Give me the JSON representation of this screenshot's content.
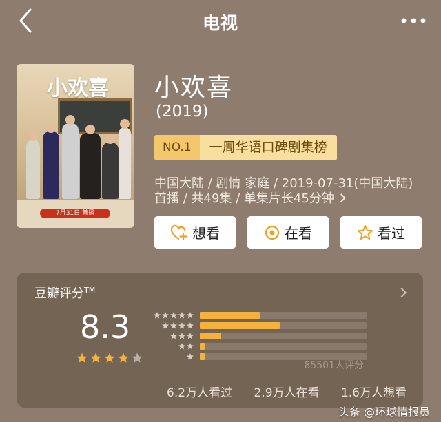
{
  "header": {
    "title": "电视",
    "back_icon": "back-chevron-icon",
    "more_icon": "more-dots-icon"
  },
  "poster": {
    "title_art": "小欢喜",
    "date_strip": "7月31日 首播"
  },
  "show": {
    "title": "小欢喜",
    "year": "(2019)",
    "rank_no": "NO.1",
    "rank_text": "一周华语口碑剧集榜",
    "meta_line1": "中国大陆 / 剧情 家庭 / 2019-07-31(中国大陆)",
    "meta_line2": "首播 / 共49集 / 单集片长45分钟"
  },
  "actions": [
    {
      "label": "想看",
      "icon": "heart-plus-icon"
    },
    {
      "label": "在看",
      "icon": "target-circle-icon"
    },
    {
      "label": "看过",
      "icon": "star-outline-icon"
    }
  ],
  "rating": {
    "label": "豆瓣评分",
    "tm": "TM",
    "score": "8.3",
    "stars_filled": 4,
    "stars_total": 5,
    "distribution": [
      {
        "stars": 5,
        "fraction": 0.36
      },
      {
        "stars": 4,
        "fraction": 0.48
      },
      {
        "stars": 3,
        "fraction": 0.13
      },
      {
        "stars": 2,
        "fraction": 0.03
      },
      {
        "stars": 1,
        "fraction": 0.03
      }
    ],
    "count": "85501人评分",
    "watched": "6.2万人看过",
    "watching": "2.9万人在看",
    "want": "1.6万人想看"
  },
  "watermark": "头条 @环球情报员",
  "colors": {
    "background": "#8e7c6e",
    "card": "#746454",
    "accent": "#f5b13d",
    "badge": "#f8df9e"
  }
}
